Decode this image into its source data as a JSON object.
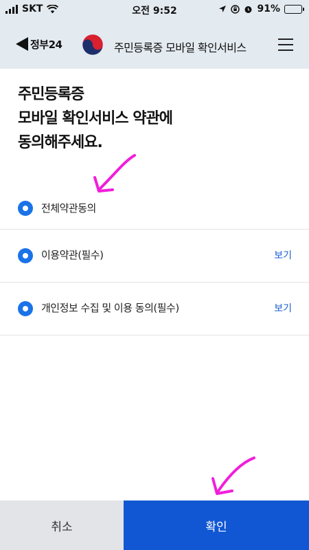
{
  "status_bar": {
    "carrier": "SKT",
    "time": "오전 9:52",
    "battery": "91%",
    "battery_level": 0.91
  },
  "navbar": {
    "back_label": "정부24",
    "title": "주민등록증 모바일 확인서비스",
    "back_icon": "back-triangle-icon",
    "emblem_icon": "taegeuk-emblem-icon",
    "menu_icon": "hamburger-menu-icon"
  },
  "heading": {
    "lines": [
      "주민등록증",
      "모바일 확인서비스 약관에",
      "동의해주세요."
    ]
  },
  "agreements": [
    {
      "label": "전체약관동의",
      "checked": true,
      "view_label": ""
    },
    {
      "label": "이용약관(필수)",
      "checked": true,
      "view_label": "보기"
    },
    {
      "label": "개인정보 수집 및 이용 동의(필수)",
      "checked": true,
      "view_label": "보기"
    }
  ],
  "footer": {
    "cancel_label": "취소",
    "confirm_label": "확인"
  },
  "colors": {
    "header_bg": "#e3eaf0",
    "radio": "#1a73e8",
    "link": "#1a5fd0",
    "confirm_bg": "#1157d3",
    "cancel_bg": "#e2e4e8",
    "annotation": "#f21ddb"
  }
}
